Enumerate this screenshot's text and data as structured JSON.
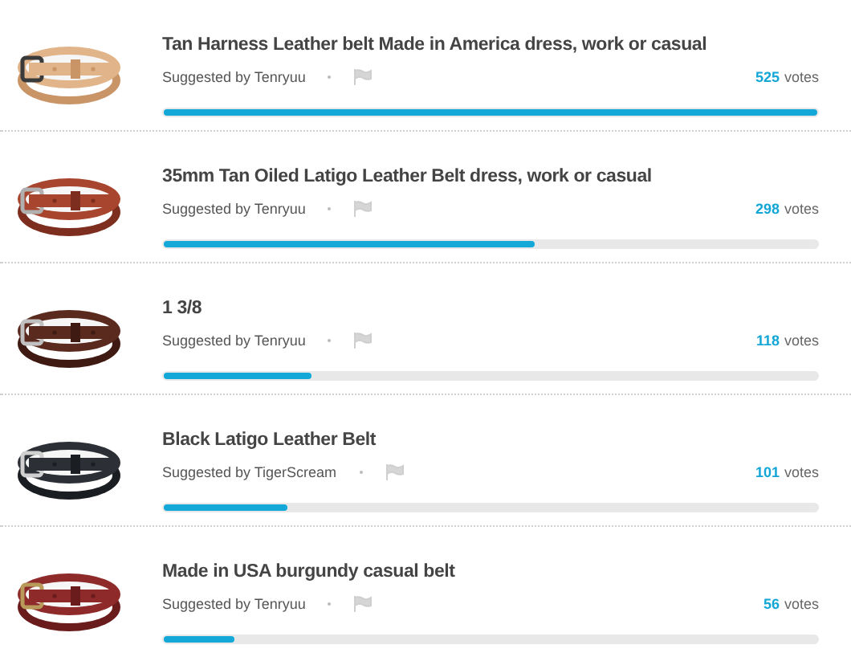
{
  "items": [
    {
      "kind": "picture",
      "title": "Tan Harness Leather belt Made in America dress, work or casual",
      "suggested_by": "Suggested by Tenryuu",
      "count": "525",
      "count_label": "votes",
      "level": 1.0
    },
    {
      "kind": "picture",
      "title": "35mm Tan Oiled Latigo Leather Belt dress, work or casual",
      "suggested_by": "Suggested by Tenryuu",
      "count": "298",
      "count_label": "votes",
      "level": 0.567
    },
    {
      "kind": "picture",
      "title": "1 3/8",
      "suggested_by": "Suggested by Tenryuu",
      "count": "118",
      "count_label": "votes",
      "level": 0.225
    },
    {
      "kind": "picture",
      "title": "Black Latigo Leather Belt",
      "suggested_by": "Suggested by TigerScream",
      "count": "101",
      "count_label": "votes",
      "level": 0.19
    },
    {
      "kind": "picture",
      "title": "Made in USA burgundy casual belt",
      "suggested_by": "Suggested by Tenryuu",
      "count": "56",
      "count_label": "votes",
      "level": 0.107
    }
  ]
}
